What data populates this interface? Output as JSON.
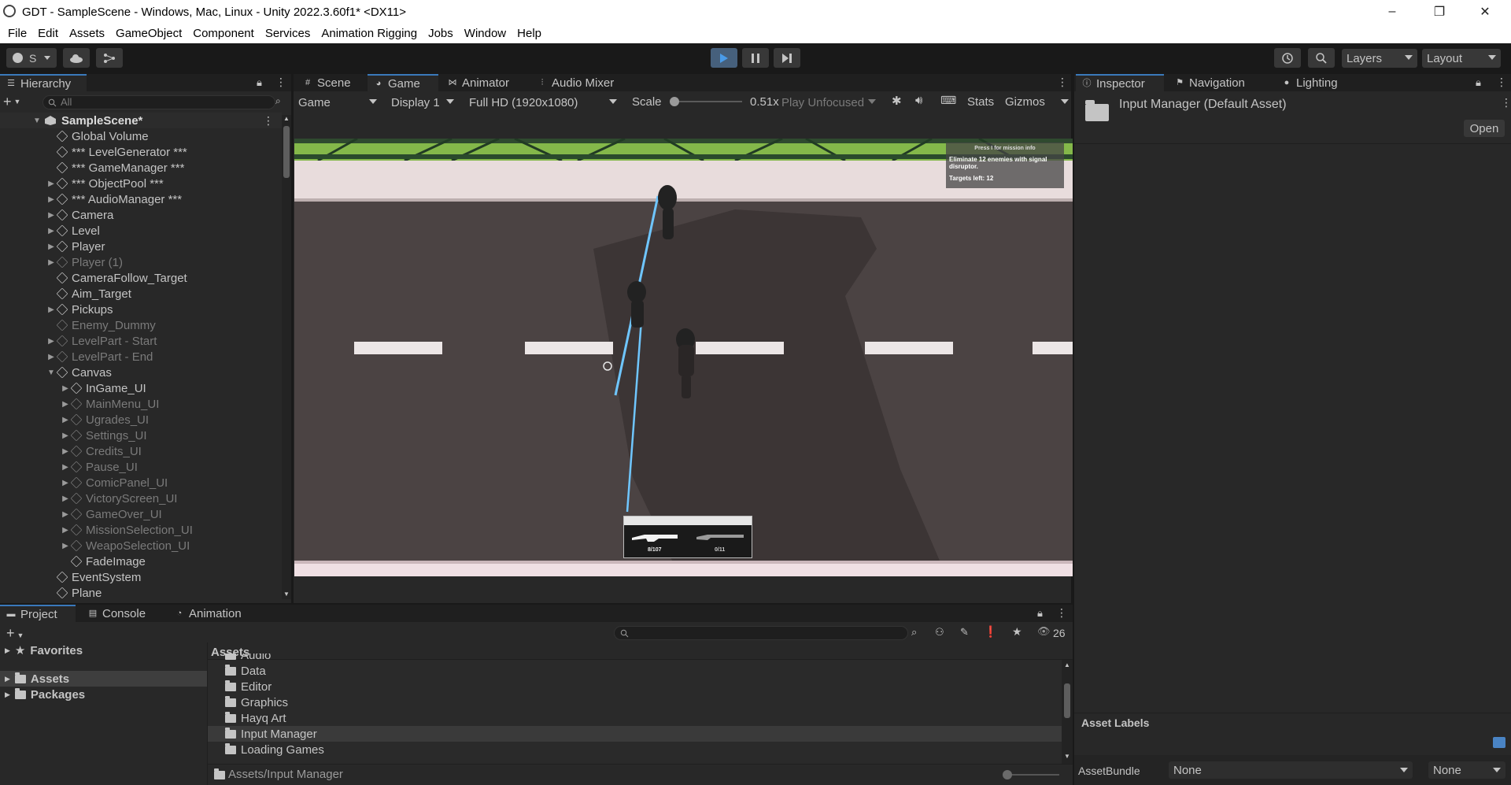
{
  "window": {
    "title": "GDT - SampleScene - Windows, Mac, Linux - Unity 2022.3.60f1* <DX11>",
    "controls": {
      "minimize": "–",
      "maximize": "❐",
      "close": "✕"
    }
  },
  "menu": [
    "File",
    "Edit",
    "Assets",
    "GameObject",
    "Component",
    "Services",
    "Animation Rigging",
    "Jobs",
    "Window",
    "Help"
  ],
  "toolbar": {
    "account_label": "S",
    "layers_label": "Layers",
    "layout_label": "Layout"
  },
  "hierarchy": {
    "tab_label": "Hierarchy",
    "search_placeholder": "All",
    "scene_name": "SampleScene*",
    "items": [
      {
        "label": "Global Volume",
        "dim": false,
        "fold": false,
        "indent": 1
      },
      {
        "label": "*** LevelGenerator ***",
        "dim": false,
        "fold": false,
        "indent": 1
      },
      {
        "label": "*** GameManager ***",
        "dim": false,
        "fold": false,
        "indent": 1
      },
      {
        "label": "*** ObjectPool ***",
        "dim": false,
        "fold": true,
        "indent": 1
      },
      {
        "label": "*** AudioManager ***",
        "dim": false,
        "fold": true,
        "indent": 1
      },
      {
        "label": "Camera",
        "dim": false,
        "fold": true,
        "indent": 1
      },
      {
        "label": "Level",
        "dim": false,
        "fold": true,
        "indent": 1
      },
      {
        "label": "Player",
        "dim": false,
        "fold": true,
        "indent": 1
      },
      {
        "label": "Player (1)",
        "dim": true,
        "fold": true,
        "indent": 1
      },
      {
        "label": "CameraFollow_Target",
        "dim": false,
        "fold": false,
        "indent": 1
      },
      {
        "label": "Aim_Target",
        "dim": false,
        "fold": false,
        "indent": 1
      },
      {
        "label": "Pickups",
        "dim": false,
        "fold": true,
        "indent": 1
      },
      {
        "label": "Enemy_Dummy",
        "dim": true,
        "fold": false,
        "indent": 1
      },
      {
        "label": "LevelPart - Start",
        "dim": true,
        "fold": true,
        "indent": 1
      },
      {
        "label": "LevelPart - End",
        "dim": true,
        "fold": true,
        "indent": 1
      },
      {
        "label": "Canvas",
        "dim": false,
        "fold": true,
        "open": true,
        "indent": 1
      },
      {
        "label": "InGame_UI",
        "dim": false,
        "fold": true,
        "indent": 2
      },
      {
        "label": "MainMenu_UI",
        "dim": true,
        "fold": true,
        "indent": 2
      },
      {
        "label": "Ugrades_UI",
        "dim": true,
        "fold": true,
        "indent": 2
      },
      {
        "label": "Settings_UI",
        "dim": true,
        "fold": true,
        "indent": 2
      },
      {
        "label": "Credits_UI",
        "dim": true,
        "fold": true,
        "indent": 2
      },
      {
        "label": "Pause_UI",
        "dim": true,
        "fold": true,
        "indent": 2
      },
      {
        "label": "ComicPanel_UI",
        "dim": true,
        "fold": true,
        "indent": 2
      },
      {
        "label": "VictoryScreen_UI",
        "dim": true,
        "fold": true,
        "indent": 2
      },
      {
        "label": "GameOver_UI",
        "dim": true,
        "fold": true,
        "indent": 2
      },
      {
        "label": "MissionSelection_UI",
        "dim": true,
        "fold": true,
        "indent": 2
      },
      {
        "label": "WeapoSelection_UI",
        "dim": true,
        "fold": true,
        "indent": 2
      },
      {
        "label": "FadeImage",
        "dim": false,
        "fold": false,
        "indent": 2
      },
      {
        "label": "EventSystem",
        "dim": false,
        "fold": false,
        "indent": 1
      },
      {
        "label": "Plane",
        "dim": false,
        "fold": false,
        "indent": 1
      }
    ]
  },
  "center_tabs": [
    "Scene",
    "Game",
    "Animator",
    "Audio Mixer"
  ],
  "game_toolbar": {
    "mode": "Game",
    "display": "Display 1",
    "resolution": "Full HD (1920x1080)",
    "scale_label": "Scale",
    "scale_value": "0.51x",
    "play_focus": "Play Unfocused",
    "stats": "Stats",
    "gizmos": "Gizmos"
  },
  "game_hud": {
    "mission_hint": "Press I for mission info",
    "mission_text": "Eliminate 12 enemies with signal disruptor.",
    "targets_left": "Targets left: 12",
    "ammo_primary": "8/107",
    "ammo_secondary": "0/11"
  },
  "inspector": {
    "tabs": [
      "Inspector",
      "Navigation",
      "Lighting"
    ],
    "asset_title": "Input Manager (Default Asset)",
    "open_button": "Open",
    "asset_labels": "Asset Labels",
    "assetbundle_label": "AssetBundle",
    "assetbundle_value": "None",
    "assetbundle_variant": "None"
  },
  "bottom_tabs": [
    "Project",
    "Console",
    "Animation"
  ],
  "project": {
    "hidden_count": "26",
    "favorites": "Favorites",
    "tree": [
      "Assets",
      "Packages"
    ],
    "assets_header": "Assets",
    "folders": [
      "Audio",
      "Data",
      "Editor",
      "Graphics",
      "Hayq Art",
      "Input Manager",
      "Loading Games"
    ],
    "selected_folder": "Input Manager",
    "path": "Assets/Input Manager"
  }
}
